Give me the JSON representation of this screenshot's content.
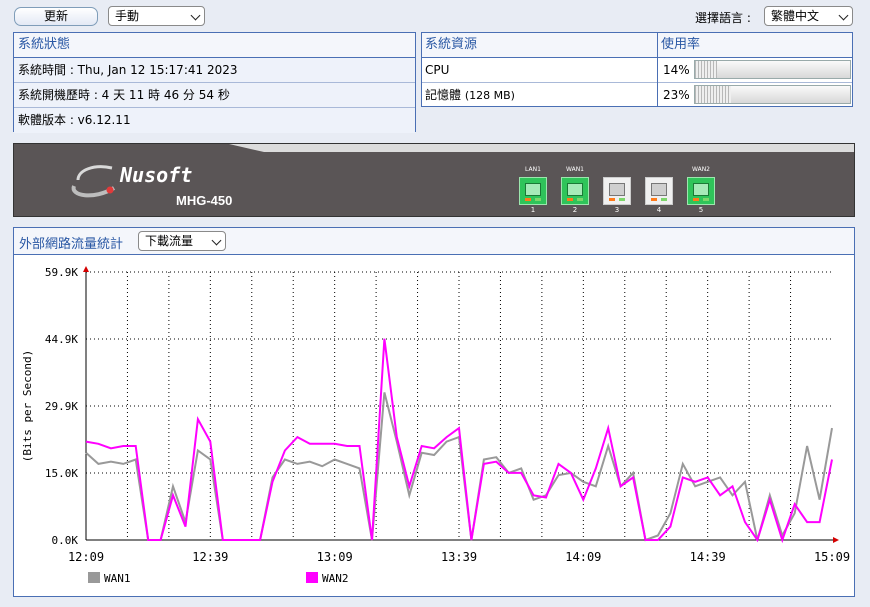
{
  "toolbar": {
    "refresh_label": "更新",
    "mode_value": "手動",
    "lang_label": "選擇語言 :",
    "lang_value": "繁體中文"
  },
  "status": {
    "header": "系統狀態",
    "time": "系統時間 : Thu, Jan 12 15:17:41 2023",
    "uptime": "系統開機歷時 : 4 天 11 時 46 分 54 秒",
    "version": "軟體版本 : v6.12.11"
  },
  "resources": {
    "header": "系統資源",
    "usage_header": "使用率",
    "rows": [
      {
        "name": "CPU",
        "usage": "14%",
        "percent": 14
      },
      {
        "name": "記憶體",
        "note": "(128 MB)",
        "usage": "23%",
        "percent": 23
      }
    ]
  },
  "device": {
    "brand": "Nusoft",
    "model": "MHG-450",
    "ports": [
      {
        "label": "LAN1",
        "num": "1",
        "active": true
      },
      {
        "label": "WAN1",
        "num": "2",
        "active": true
      },
      {
        "label": "",
        "num": "3",
        "active": false
      },
      {
        "label": "",
        "num": "4",
        "active": false
      },
      {
        "label": "WAN2",
        "num": "5",
        "active": true
      }
    ]
  },
  "traffic": {
    "title": "外部網路流量統計",
    "direction_value": "下載流量"
  },
  "chart_data": {
    "type": "line",
    "ylabel": "(Bits per Second)",
    "y_ticks": [
      "0.0K",
      "15.0K",
      "29.9K",
      "44.9K",
      "59.9K"
    ],
    "ylim": [
      0,
      59.9
    ],
    "x_ticks": [
      "12:09",
      "12:39",
      "13:09",
      "13:39",
      "14:09",
      "14:39",
      "15:09"
    ],
    "grid": true,
    "legend_position": "bottom-left",
    "series": [
      {
        "name": "WAN1",
        "color": "#999999",
        "values": [
          19.5,
          17,
          17.5,
          17,
          18,
          0,
          0,
          12,
          4,
          20,
          18,
          0,
          0,
          0,
          0,
          14,
          18,
          17,
          17.5,
          16.5,
          18,
          17,
          16,
          0,
          33,
          22,
          10,
          19.5,
          19,
          22,
          23,
          0,
          18,
          18.5,
          15,
          16,
          9,
          10,
          14.5,
          15,
          13,
          12,
          21,
          12,
          15,
          0,
          1,
          6,
          17,
          12,
          13,
          14,
          10,
          13,
          0,
          10,
          1,
          6,
          21,
          9,
          25
        ]
      },
      {
        "name": "WAN2",
        "color": "#ff00ff",
        "values": [
          22,
          21.5,
          20.5,
          21,
          21,
          0,
          0,
          10,
          3,
          27,
          22,
          0,
          0,
          0,
          0,
          13,
          20,
          23,
          21.5,
          21.5,
          21.5,
          21,
          21,
          0,
          45,
          23,
          12,
          21,
          20.5,
          23,
          25,
          0,
          17,
          17.5,
          15,
          15,
          10,
          9.5,
          17,
          15,
          9,
          16,
          25,
          12,
          14,
          0,
          0,
          3,
          14,
          13,
          14,
          10,
          12,
          4,
          0,
          9,
          0,
          8,
          4,
          4,
          18
        ]
      }
    ]
  }
}
